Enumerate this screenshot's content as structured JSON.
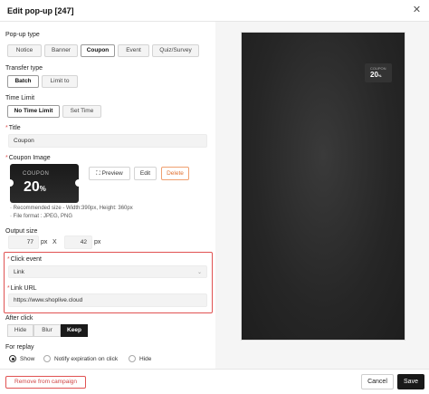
{
  "header": {
    "title": "Edit pop-up [247]",
    "close_icon": "close-icon"
  },
  "popup_type": {
    "label": "Pop-up type",
    "options": [
      "Notice",
      "Banner",
      "Coupon",
      "Event",
      "Quiz/Survey"
    ],
    "selected": "Coupon"
  },
  "transfer_type": {
    "label": "Transfer type",
    "options": [
      "Batch",
      "Limit to"
    ],
    "selected": "Batch"
  },
  "time_limit": {
    "label": "Time Limit",
    "options": [
      "No Time Limit",
      "Set Time"
    ],
    "selected": "No Time Limit"
  },
  "title_field": {
    "label": "Title",
    "value": "Coupon"
  },
  "coupon_image": {
    "label": "Coupon Image",
    "thumb_small": "COUPON",
    "thumb_big": "20",
    "thumb_unit": "%",
    "preview_label": "Preview",
    "edit_label": "Edit",
    "delete_label": "Delete",
    "note_size": "· Recommended size - Width:390px, Height: 360px",
    "note_format": "· File format : JPEG, PNG"
  },
  "output_size": {
    "label": "Output size",
    "width": "77",
    "height": "42",
    "unit": "px",
    "times": "X"
  },
  "click_event": {
    "label": "Click event",
    "value": "Link"
  },
  "link_url": {
    "label": "Link URL",
    "value": "https://www.shoplive.cloud"
  },
  "after_click": {
    "label": "After click",
    "options": [
      "Hide",
      "Blur",
      "Keep"
    ],
    "selected": "Keep"
  },
  "for_replay": {
    "label": "For replay",
    "options": [
      "Show",
      "Notify expiration on click",
      "Hide"
    ],
    "selected": "Show"
  },
  "footer": {
    "remove_label": "Remove from campaign",
    "cancel_label": "Cancel",
    "save_label": "Save"
  },
  "preview": {
    "coupon_small": "COUPON",
    "coupon_big": "20",
    "coupon_unit": "%"
  },
  "colors": {
    "accent": "#1a1a1a",
    "danger": "#e05252",
    "delete_orange": "#e07030"
  }
}
